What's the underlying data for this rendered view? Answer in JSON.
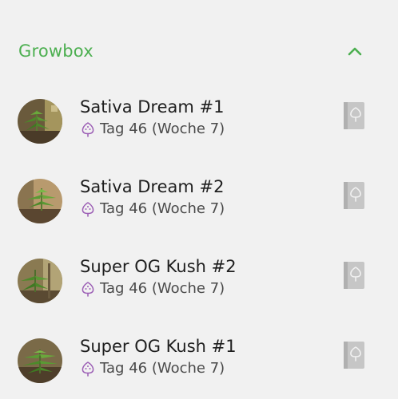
{
  "section": {
    "title": "Growbox",
    "collapse_icon": "chevron-up-icon",
    "accent_color": "#4caf50"
  },
  "plants": [
    {
      "name": "Sativa Dream #1",
      "age": "Tag 46 (Woche 7)",
      "stage_icon": "plant-stage-icon",
      "action_icon": "journal-icon"
    },
    {
      "name": "Sativa Dream #2",
      "age": "Tag 46 (Woche 7)",
      "stage_icon": "plant-stage-icon",
      "action_icon": "journal-icon"
    },
    {
      "name": "Super OG Kush #2",
      "age": "Tag 46 (Woche 7)",
      "stage_icon": "plant-stage-icon",
      "action_icon": "journal-icon"
    },
    {
      "name": "Super OG Kush #1",
      "age": "Tag 46 (Woche 7)",
      "stage_icon": "plant-stage-icon",
      "action_icon": "journal-icon"
    }
  ],
  "colors": {
    "stage_icon": "#9c5fb5",
    "journal_icon": "#c6c6c6",
    "background": "#f1f1f1"
  }
}
